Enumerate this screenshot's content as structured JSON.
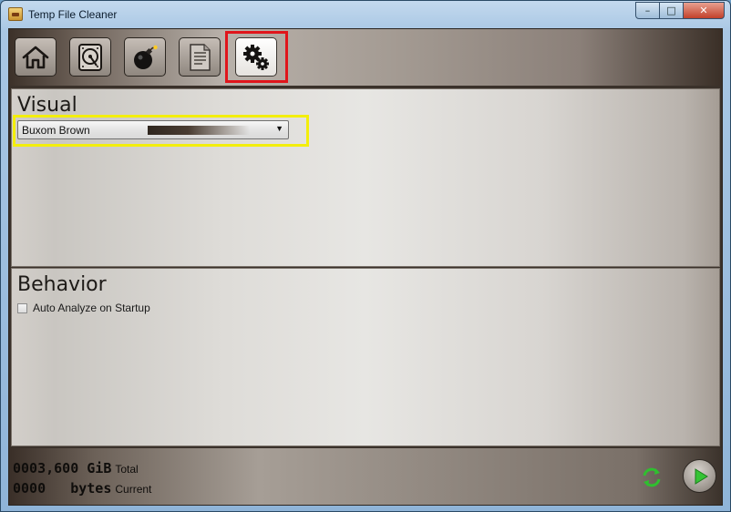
{
  "window": {
    "title": "Temp File Cleaner",
    "controls": {
      "minimize": "–",
      "maximize": "□",
      "close": "✕"
    }
  },
  "toolbar": {
    "buttons": [
      {
        "name": "home",
        "icon": "home-icon"
      },
      {
        "name": "drives",
        "icon": "hard-drive-icon"
      },
      {
        "name": "clean",
        "icon": "bomb-icon"
      },
      {
        "name": "log",
        "icon": "document-icon"
      },
      {
        "name": "settings",
        "icon": "gears-icon",
        "active": true
      }
    ]
  },
  "visual": {
    "heading": "Visual",
    "theme_select": {
      "value": "Buxom Brown"
    }
  },
  "behavior": {
    "heading": "Behavior",
    "auto_analyze": {
      "label": "Auto Analyze on Startup",
      "checked": false
    }
  },
  "status": {
    "total_value": "0003,600 GiB",
    "total_label": "Total",
    "current_value": "0000   bytes",
    "current_label": "Current"
  },
  "colors": {
    "highlight_red": "#e0151b",
    "highlight_yellow": "#f3ee0c",
    "refresh_green": "#2fbf2f",
    "play_green": "#35c435"
  }
}
